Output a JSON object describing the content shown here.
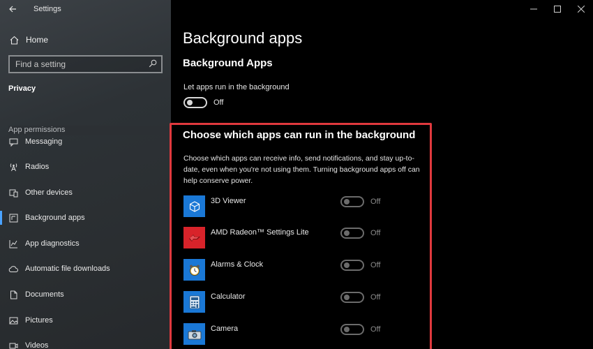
{
  "window": {
    "title": "Settings"
  },
  "sidebar": {
    "home_label": "Home",
    "search_placeholder": "Find a setting",
    "section_heading": "Privacy",
    "group_heading": "App permissions",
    "items": [
      {
        "label": "Messaging",
        "icon": "messaging-icon",
        "selected": false
      },
      {
        "label": "Radios",
        "icon": "radio-tower-icon",
        "selected": false
      },
      {
        "label": "Other devices",
        "icon": "other-devices-icon",
        "selected": false
      },
      {
        "label": "Background apps",
        "icon": "background-apps-icon",
        "selected": true
      },
      {
        "label": "App diagnostics",
        "icon": "diagnostics-chart-icon",
        "selected": false
      },
      {
        "label": "Automatic file downloads",
        "icon": "cloud-icon",
        "selected": false
      },
      {
        "label": "Documents",
        "icon": "document-icon",
        "selected": false
      },
      {
        "label": "Pictures",
        "icon": "picture-icon",
        "selected": false
      },
      {
        "label": "Videos",
        "icon": "video-icon",
        "selected": false
      }
    ]
  },
  "main": {
    "page_title": "Background apps",
    "section_title": "Background Apps",
    "master_toggle": {
      "label": "Let apps run in the background",
      "state": "Off"
    },
    "choose": {
      "title": "Choose which apps can run in the background",
      "description": "Choose which apps can receive info, send notifications, and stay up-to-date, even when you're not using them. Turning background apps off can help conserve power."
    },
    "apps": [
      {
        "name": "3D Viewer",
        "state": "Off",
        "icon": "3d-viewer-icon"
      },
      {
        "name": "AMD Radeon™ Settings Lite",
        "state": "Off",
        "icon": "amd-radeon-icon"
      },
      {
        "name": "Alarms & Clock",
        "state": "Off",
        "icon": "alarm-clock-icon"
      },
      {
        "name": "Calculator",
        "state": "Off",
        "icon": "calculator-icon"
      },
      {
        "name": "Camera",
        "state": "Off",
        "icon": "camera-icon"
      }
    ]
  },
  "colors": {
    "accent": "#1a78d6",
    "highlight": "#e0393e",
    "selection_bar": "#4aa3ff"
  }
}
